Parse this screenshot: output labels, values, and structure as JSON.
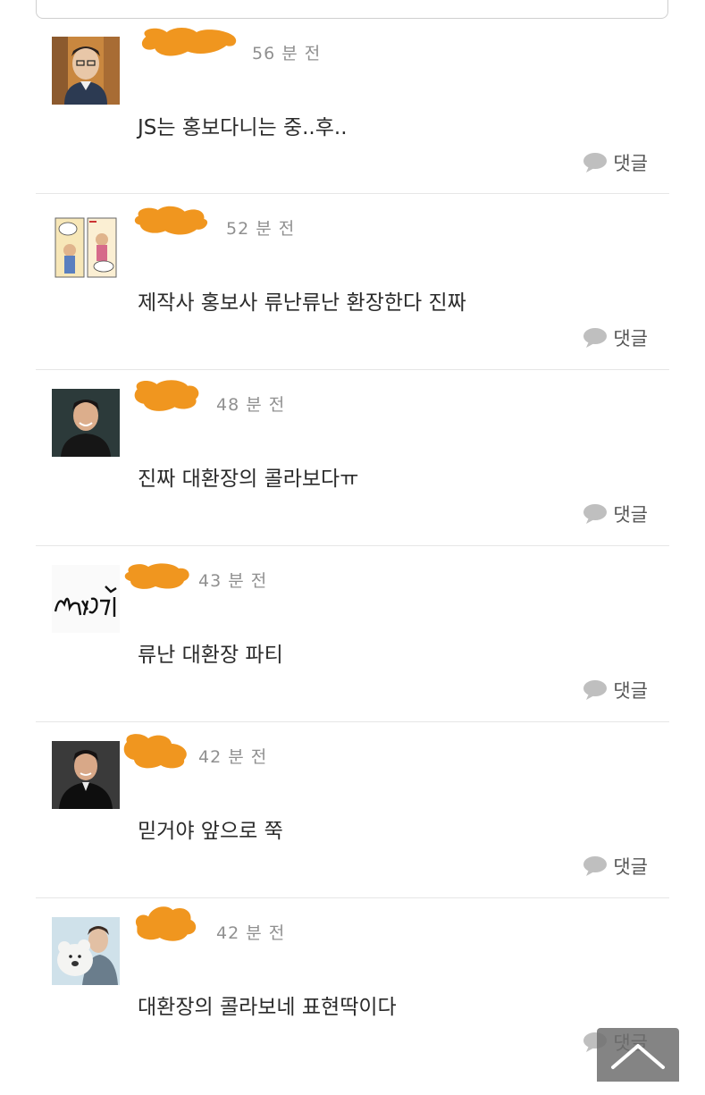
{
  "comments": [
    {
      "timestamp": "56 분 전",
      "text": "JS는 홍보다니는 중..후..",
      "reply_label": "댓글",
      "avatar": "man-portrait-orange-background"
    },
    {
      "timestamp": "52 분 전",
      "text": "제작사 홍보사 류난류난 환장한다 진짜",
      "reply_label": "댓글",
      "avatar": "comic-strip"
    },
    {
      "timestamp": "48 분 전",
      "text": "진짜 대환장의 콜라보다ㅠ",
      "reply_label": "댓글",
      "avatar": "man-portrait-dark-background"
    },
    {
      "timestamp": "43 분 전",
      "text": "류난 대환장 파티",
      "reply_label": "댓글",
      "avatar": "handwritten-signature"
    },
    {
      "timestamp": "42 분 전",
      "text": "믿거야 앞으로 쭉",
      "reply_label": "댓글",
      "avatar": "man-portrait-suit"
    },
    {
      "timestamp": "42 분 전",
      "text": "대환장의 콜라보네 표현딱이다",
      "reply_label": "댓글",
      "avatar": "man-with-teddy-bear"
    }
  ],
  "colors": {
    "redaction": "#f0961f",
    "timestamp": "#909090",
    "divider": "#e6e6e6",
    "reply_icon": "#bfbfbf"
  },
  "icons": {
    "reply": "speech-bubble-icon",
    "scroll_top": "chevron-up-icon"
  }
}
